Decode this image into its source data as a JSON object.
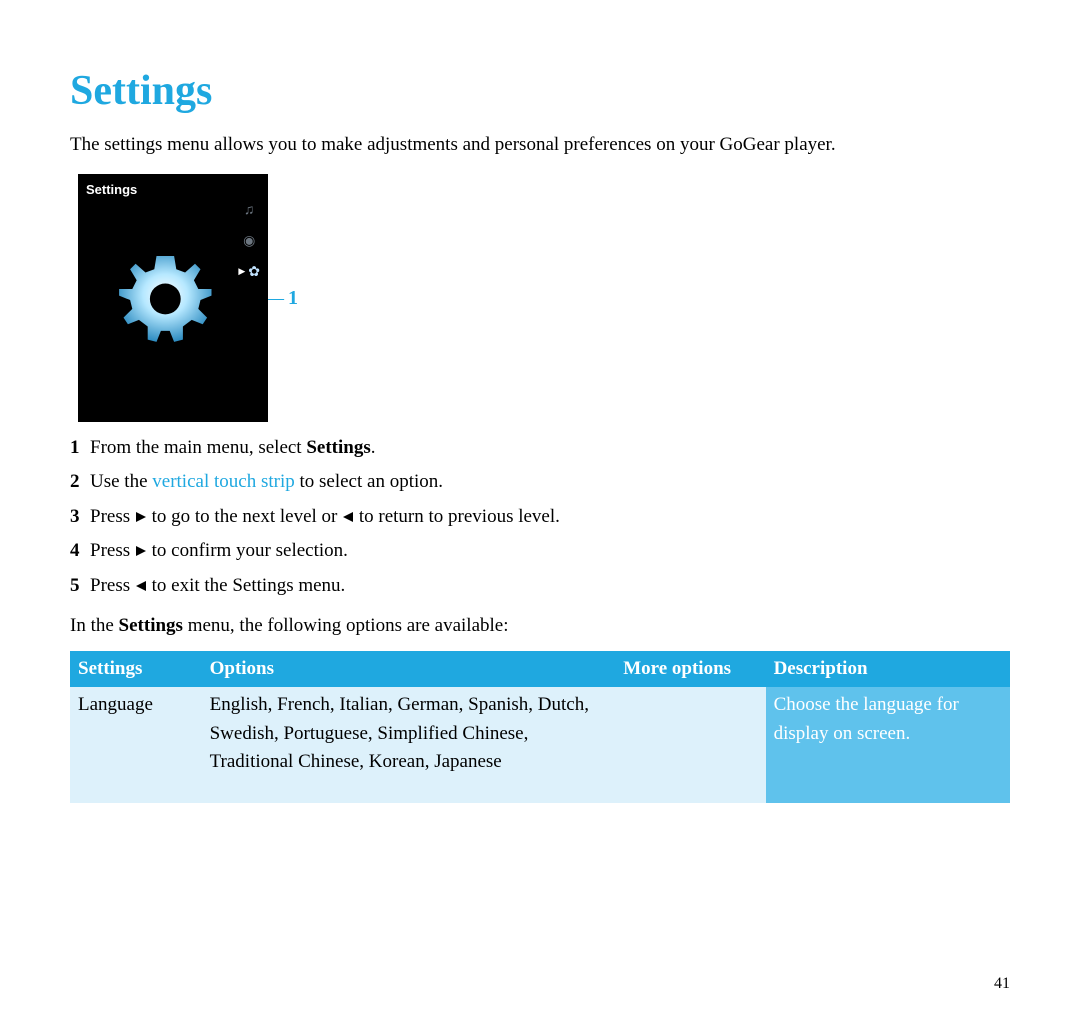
{
  "title": "Settings",
  "intro": "The settings menu allows you to make adjustments and personal preferences on your GoGear player.",
  "device": {
    "title": "Settings"
  },
  "callout": {
    "num": "1"
  },
  "steps": {
    "s1a": "From the main menu, select ",
    "s1b": "Settings",
    "s1c": ".",
    "s2a": "Use the ",
    "s2b": "vertical touch strip",
    "s2c": " to select an option.",
    "s3a": "Press ",
    "s3b": " to go to the next level or ",
    "s3c": " to return to previous level.",
    "s4a": "Press ",
    "s4b": " to confirm your selection.",
    "s5a": "Press ",
    "s5b": " to exit the Settings menu."
  },
  "after_a": "In the ",
  "after_b": "Settings",
  "after_c": " menu, the following options are available:",
  "table": {
    "headers": [
      "Settings",
      "Options",
      "More options",
      "Description"
    ],
    "row": {
      "setting": "Language",
      "options": "English, French, Italian, German, Spanish, Dutch, Swedish, Portuguese, Simplified Chinese, Traditional Chinese, Korean, Japanese",
      "more": "",
      "desc": "Choose the language for display on screen."
    }
  },
  "pageno": "41"
}
